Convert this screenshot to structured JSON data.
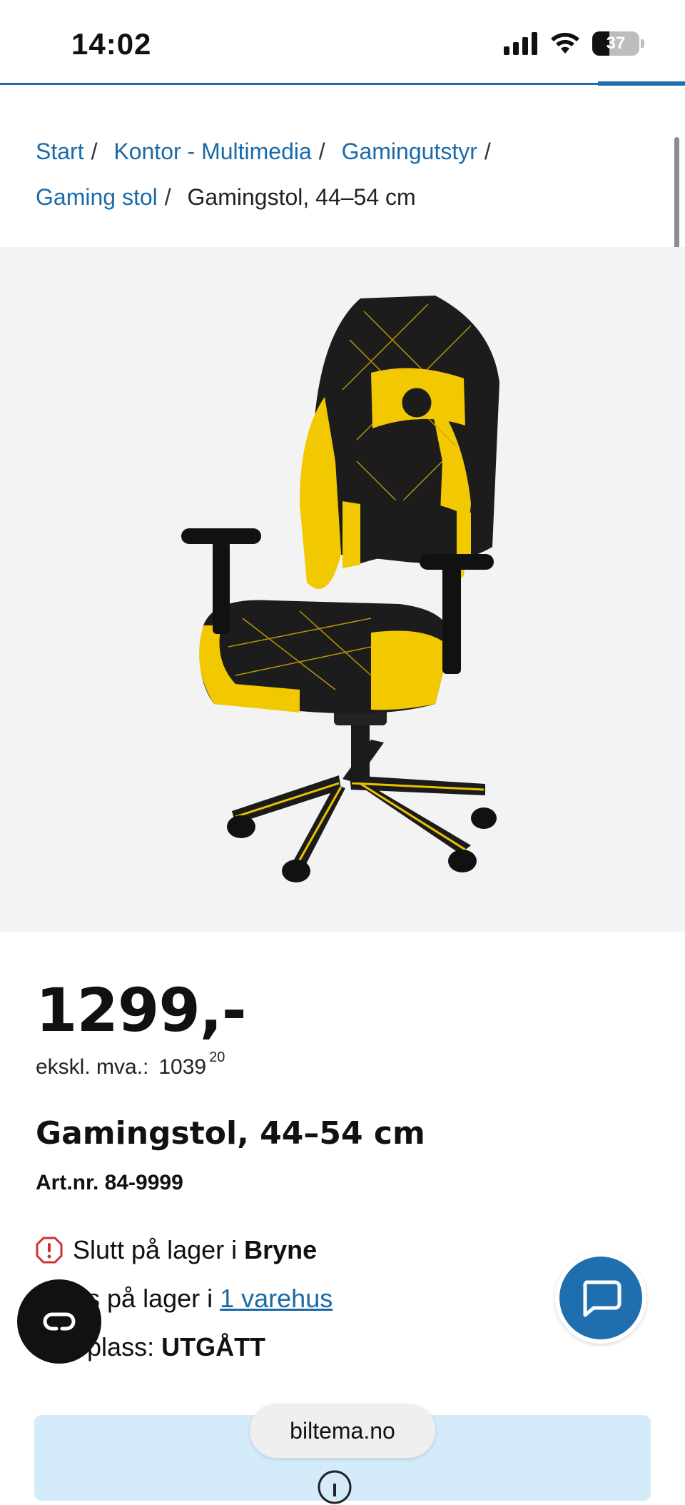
{
  "status_bar": {
    "time": "14:02",
    "battery": "37",
    "battery_level": 0.37
  },
  "breadcrumb": {
    "items": [
      "Start",
      "Kontor - Multimedia",
      "Gamingutstyr",
      "Gaming stol"
    ],
    "separator": "/",
    "current": "Gamingstol, 44–54 cm"
  },
  "product": {
    "image_icon": "gaming-chair-image",
    "price": "1299,-",
    "ex_vat_label": "ekskl. mva.:",
    "ex_vat_value": "1039",
    "ex_vat_decimals": "20",
    "title": "Gamingstol, 44–54 cm",
    "article_number": "Art.nr. 84-9999"
  },
  "stock": {
    "store_status_prefix": "Slutt på lager i",
    "store_name": "Bryne",
    "other_stores_prefix": "es på lager i",
    "other_stores_link": "1 varehus",
    "warehouse_prefix": "eplass:",
    "warehouse_status": "UTGÅTT"
  },
  "overlay": {
    "url": "biltema.no",
    "compare_icon": "compare-icon",
    "chat_icon": "chat-icon"
  },
  "colors": {
    "accent": "#1f6fb0",
    "link": "#1a6aa8",
    "image_bg": "#f3f3f3",
    "info_box": "#d4ebfa",
    "warning": "#d32f2f"
  }
}
